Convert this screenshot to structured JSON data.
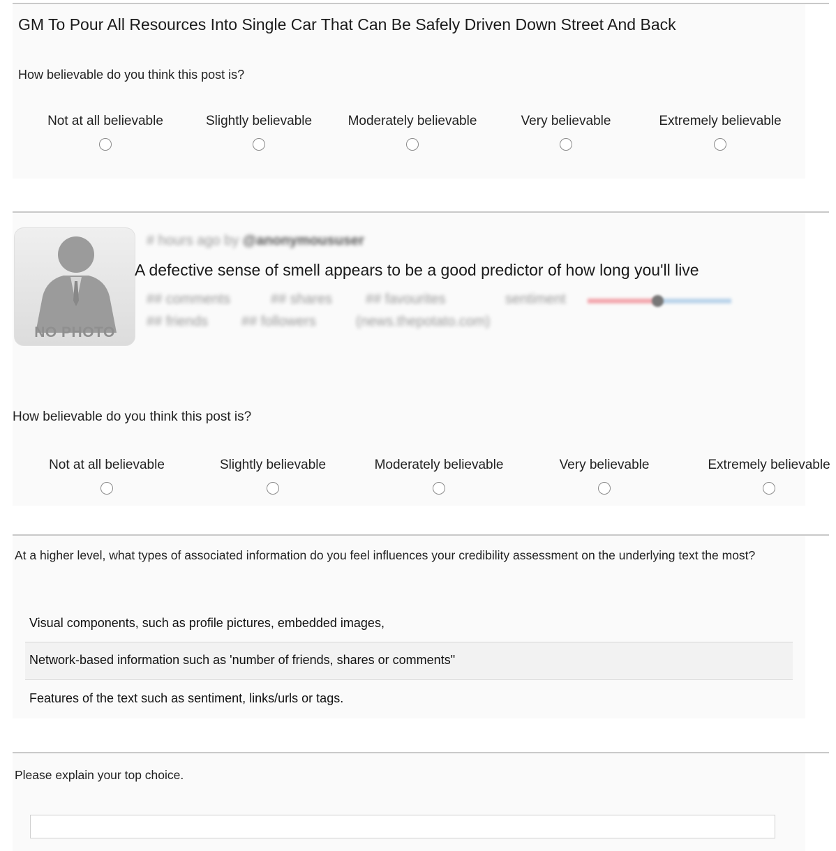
{
  "post1": {
    "headline": "GM To Pour All Resources Into Single Car That Can Be Safely Driven Down Street And Back",
    "question": "How believable do you think this post is?",
    "scale": [
      "Not at all believable",
      "Slightly believable",
      "Moderately believable",
      "Very believable",
      "Extremely believable"
    ]
  },
  "post2": {
    "meta": "# hours ago by",
    "user": "@anonymoususer",
    "text": "A defective sense of smell appears to be a good predictor of how long you'll live",
    "stats_row1": [
      "## comments",
      "## shares",
      "## favourites",
      "sentiment"
    ],
    "stats_row2": [
      "## friends",
      "## followers",
      "(news.thepotato.com)"
    ],
    "avatar_label": "NO PHOTO",
    "sentiment_colors": {
      "negative": "#f2a6ad",
      "positive": "#b9d3ea",
      "marker": "#777777"
    },
    "question": "How believable do you think this post is?",
    "scale": [
      "Not at all believable",
      "Slightly believable",
      "Moderately believable",
      "Very believable",
      "Extremely believable"
    ]
  },
  "q3": {
    "question": "At a higher level, what types of associated information do you feel influences your credibility assessment on the underlying text the most?",
    "options": [
      "Visual components, such as profile pictures, embedded images,",
      "Network-based information such as 'number of friends, shares or comments\"",
      "Features of the text such as sentiment, links/urls or tags."
    ]
  },
  "q4": {
    "question": "Please explain your top choice.",
    "value": ""
  }
}
